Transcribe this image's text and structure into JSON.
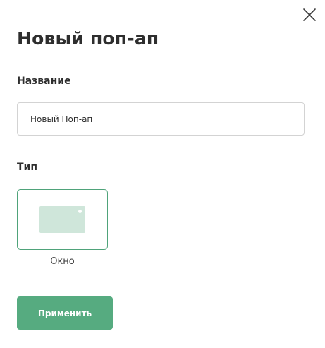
{
  "dialog": {
    "title": "Новый поп-ап",
    "close_icon": "close-icon"
  },
  "name_section": {
    "label": "Название",
    "input_value": "Новый Поп-ап"
  },
  "type_section": {
    "label": "Тип",
    "options": [
      {
        "label": "Окно",
        "icon": "window-preview-icon",
        "selected": true
      }
    ]
  },
  "actions": {
    "apply_label": "Применить"
  },
  "colors": {
    "accent": "#56ab80",
    "selected_border": "#4fa37a",
    "preview_fill": "#cfe6da"
  }
}
